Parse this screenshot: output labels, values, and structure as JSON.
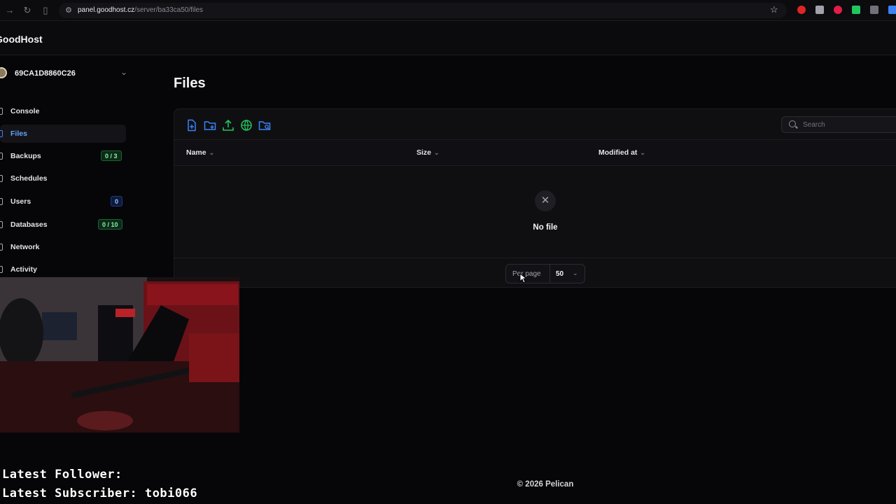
{
  "browser": {
    "url_host": "panel.goodhost.cz",
    "url_path": "/server/ba33ca50/files"
  },
  "app": {
    "brand": "GoodHost"
  },
  "server": {
    "name": "69CA1D8860C26"
  },
  "sidebar": {
    "items": [
      {
        "label": "Console"
      },
      {
        "label": "Files",
        "active": true
      },
      {
        "label": "Backups",
        "badge": "0 / 3"
      },
      {
        "label": "Schedules"
      },
      {
        "label": "Users",
        "badge": "0"
      },
      {
        "label": "Databases",
        "badge": "0 / 10"
      },
      {
        "label": "Network"
      },
      {
        "label": "Activity"
      }
    ]
  },
  "page": {
    "title": "Files"
  },
  "toolbar": {
    "icons": [
      "new-file-icon",
      "new-folder-icon",
      "upload-icon",
      "pull-remote-icon",
      "search-folder-icon"
    ],
    "search_placeholder": "Search"
  },
  "table": {
    "columns": [
      "Name",
      "Size",
      "Modified at"
    ],
    "empty_text": "No file"
  },
  "pagination": {
    "label": "Per page",
    "value": "50"
  },
  "footer": {
    "text": "© 2026 Pelican"
  },
  "stream_overlay": {
    "latest_follower": "Latest Follower:",
    "latest_subscriber": "Latest Subscriber: tobi066"
  },
  "colors": {
    "accent": "#3b82f6",
    "badge_green": "#86efac",
    "background": "#060608"
  }
}
